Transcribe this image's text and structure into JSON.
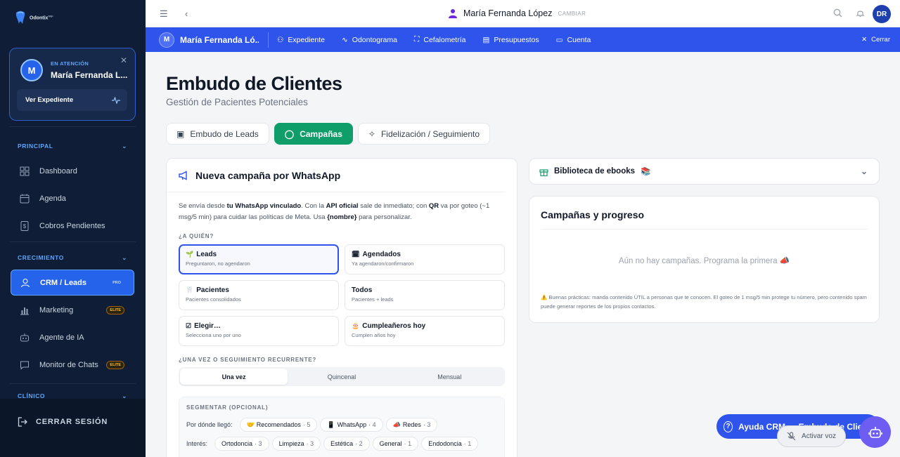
{
  "logo": {
    "name": "Odontix",
    "sup": "app"
  },
  "attention": {
    "label": "EN ATENCIÓN",
    "name": "María Fernanda L...",
    "avatar": "M",
    "button": "Ver Expediente"
  },
  "nav": {
    "principal": {
      "title": "PRINCIPAL",
      "items": [
        {
          "label": "Dashboard",
          "icon": "dashboard-icon"
        },
        {
          "label": "Agenda",
          "icon": "calendar-icon"
        },
        {
          "label": "Cobros Pendientes",
          "icon": "dollar-icon"
        }
      ]
    },
    "crecimiento": {
      "title": "CRECIMIENTO",
      "items": [
        {
          "label": "CRM / Leads",
          "badge": "PRO"
        },
        {
          "label": "Marketing",
          "badge": "ELITE"
        },
        {
          "label": "Agente de IA"
        },
        {
          "label": "Monitor de Chats",
          "badge": "ELITE"
        }
      ]
    },
    "clinico": {
      "title": "CLÍNICO"
    },
    "logout": "CERRAR SESIÓN"
  },
  "topbar": {
    "user": "María Fernanda López",
    "change": "CAMBIAR",
    "avatar": "DR"
  },
  "bluebar": {
    "avatar": "M",
    "name": "María Fernanda Ló...",
    "links": [
      "Expediente",
      "Odontograma",
      "Cefalometría",
      "Presupuestos",
      "Cuenta"
    ],
    "close": "Cerrar"
  },
  "page": {
    "title": "Embudo de Clientes",
    "subtitle": "Gestión de Pacientes Potenciales"
  },
  "tabs": [
    "Embudo de Leads",
    "Campañas",
    "Fidelización / Seguimiento"
  ],
  "campaign": {
    "title": "Nueva campaña por WhatsApp",
    "desc_1": "Se envía desde ",
    "desc_b1": "tu WhatsApp vinculado",
    "desc_2": ". Con la ",
    "desc_b2": "API oficial",
    "desc_3": " sale de inmediato; con ",
    "desc_b3": "QR",
    "desc_4": " va por goteo (~1 msg/5 min) para cuidar las políticas de Meta. Usa ",
    "desc_b4": "{nombre}",
    "desc_5": " para personalizar.",
    "who_label": "¿A QUIÉN?",
    "options": [
      {
        "emoji": "🌱",
        "title": "Leads",
        "sub": "Preguntaron, no agendaron"
      },
      {
        "emoji": "🗓",
        "title": "Agendados",
        "sub": "Ya agendaron/confirmaron"
      },
      {
        "emoji": "🦷",
        "title": "Pacientes",
        "sub": "Pacientes consolidados"
      },
      {
        "emoji": "",
        "title": "Todos",
        "sub": "Pacientes + leads"
      },
      {
        "emoji": "☑",
        "title": "Elegir…",
        "sub": "Selecciona uno por uno"
      },
      {
        "emoji": "🎂",
        "title": "Cumpleañeros hoy",
        "sub": "Cumplen años hoy"
      }
    ],
    "freq_label": "¿UNA VEZ O SEGUIMIENTO RECURRENTE?",
    "freq": [
      "Una vez",
      "Quincenal",
      "Mensual"
    ],
    "seg_label": "SEGMENTAR (OPCIONAL)",
    "source_label": "Por dónde llegó:",
    "sources": [
      {
        "emoji": "🤝",
        "label": "Recomendados",
        "count": "· 5"
      },
      {
        "emoji": "📱",
        "label": "WhatsApp",
        "count": "· 4"
      },
      {
        "emoji": "📣",
        "label": "Redes",
        "count": "· 3"
      }
    ],
    "interest_label": "Interés:",
    "interests": [
      {
        "label": "Ortodoncia",
        "count": "· 3"
      },
      {
        "label": "Limpieza",
        "count": "· 3"
      },
      {
        "label": "Estética",
        "count": "· 2"
      },
      {
        "label": "General",
        "count": "· 1"
      },
      {
        "label": "Endodoncia",
        "count": "· 1"
      }
    ]
  },
  "library": {
    "title": "Biblioteca de ebooks",
    "emoji": "📚"
  },
  "progress": {
    "title": "Campañas y progreso",
    "empty": "Aún no hay campañas. Programa la primera 📣",
    "note": "⚠️ Buenas prácticas: manda contenido ÚTIL a personas que te conocen. El goteo de 1 msg/5 min protege tu número, pero contenido spam puede generar reportes de los propios contactos."
  },
  "help": {
    "label": "Ayuda CRM — Embudo de Clientes"
  },
  "voice": {
    "label": "Activar voz"
  },
  "colors": {
    "sidebar": "#0f1e36",
    "primary": "#2f54eb",
    "accent_green": "#0f9d6a",
    "bot": "#6d5df2"
  }
}
